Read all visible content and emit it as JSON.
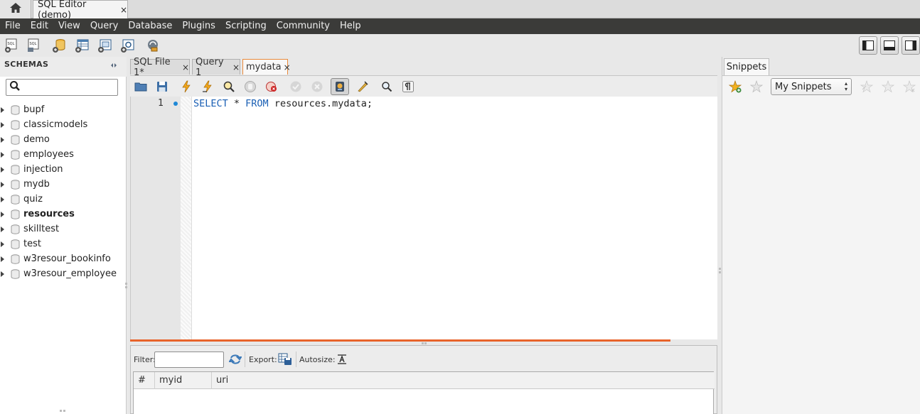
{
  "window": {
    "home_tab": "home",
    "editor_tab_label": "SQL Editor (demo)",
    "close_glyph": "×"
  },
  "menubar": {
    "items": [
      "File",
      "Edit",
      "View",
      "Query",
      "Database",
      "Plugins",
      "Scripting",
      "Community",
      "Help"
    ]
  },
  "toolbar": {
    "icons": [
      "new-sql-tab-icon",
      "open-sql-script-icon",
      "create-schema-icon",
      "create-table-icon",
      "create-view-icon",
      "create-routine-icon",
      "reconnect-icon"
    ],
    "layout_buttons": [
      "toggle-sidebar-icon",
      "toggle-output-icon",
      "toggle-secondary-sidebar-icon"
    ]
  },
  "schemas": {
    "title": "SCHEMAS",
    "search_placeholder": "",
    "items": [
      {
        "label": "bupf",
        "bold": false
      },
      {
        "label": "classicmodels",
        "bold": false
      },
      {
        "label": "demo",
        "bold": false
      },
      {
        "label": "employees",
        "bold": false
      },
      {
        "label": "injection",
        "bold": false
      },
      {
        "label": "mydb",
        "bold": false
      },
      {
        "label": "quiz",
        "bold": false
      },
      {
        "label": "resources",
        "bold": true
      },
      {
        "label": "skilltest",
        "bold": false
      },
      {
        "label": "test",
        "bold": false
      },
      {
        "label": "w3resour_bookinfo",
        "bold": false
      },
      {
        "label": "w3resour_employee",
        "bold": false
      }
    ]
  },
  "query_tabs": [
    {
      "label": "SQL File 1*",
      "active": false
    },
    {
      "label": "Query 1",
      "active": false
    },
    {
      "label": "mydata",
      "active": true
    }
  ],
  "editor": {
    "line_number": "1",
    "code": {
      "kw1": "SELECT",
      "star": " * ",
      "kw2": "FROM",
      "rest": " resources.mydata;"
    }
  },
  "results": {
    "filter_label": "Filter:",
    "filter_value": "",
    "export_label": "Export:",
    "autosize_label": "Autosize:",
    "columns": [
      "#",
      "myid",
      "uri"
    ]
  },
  "snippets": {
    "tab_label": "Snippets",
    "selected": "My Snippets"
  },
  "colors": {
    "menubar": "#3b3b39",
    "keyword": "#1a5fb4",
    "accent_orange": "#e8632a",
    "line_marker": "#1e88d6"
  }
}
